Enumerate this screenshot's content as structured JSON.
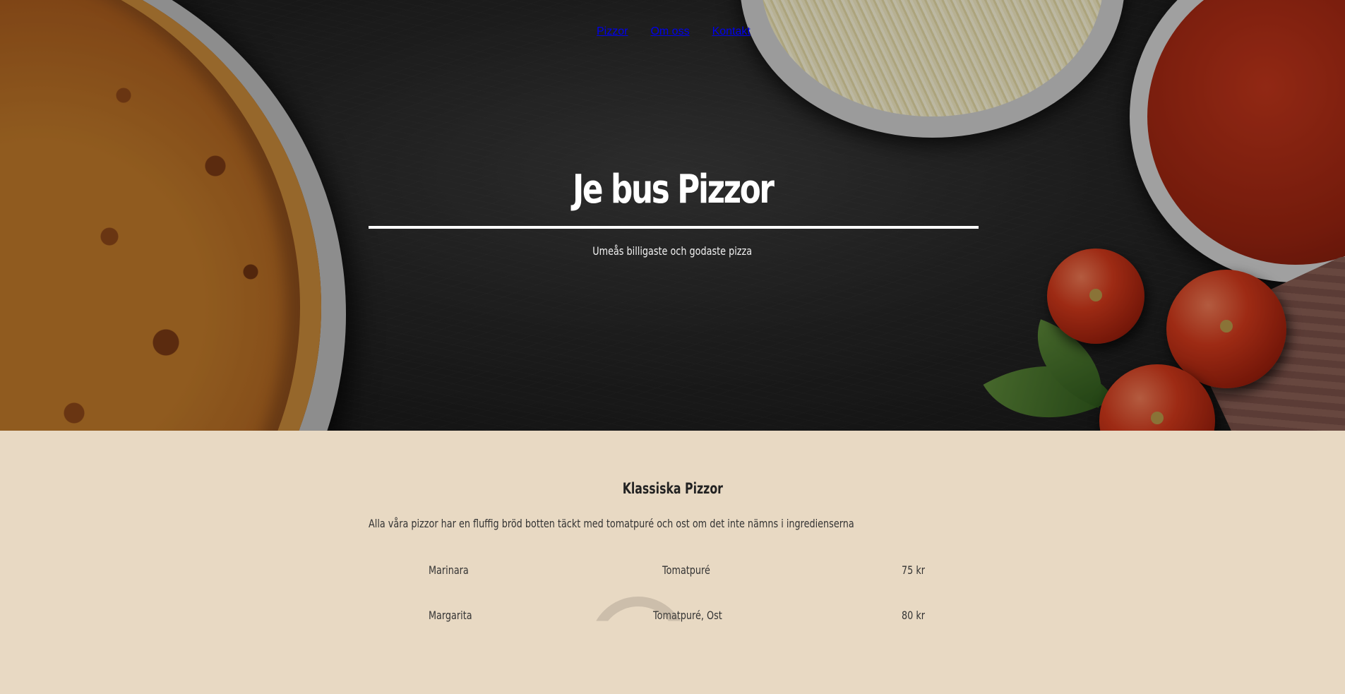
{
  "nav": {
    "items": [
      {
        "label": "Pizzor"
      },
      {
        "label": "Om oss"
      },
      {
        "label": "Kontakt"
      }
    ]
  },
  "hero": {
    "title": "Je bus Pizzor",
    "subtitle": "Umeås billigaste och godaste pizza"
  },
  "menu": {
    "title": "Klassiska Pizzor",
    "description": "Alla våra pizzor har en fluffig bröd botten täckt med tomatpuré och ost om det inte nämns i ingredienserna",
    "items": [
      {
        "name": "Marinara",
        "ingredients": "Tomatpuré",
        "price": "75 kr"
      },
      {
        "name": "Margarita",
        "ingredients": "Tomatpuré, Ost",
        "price": "80 kr"
      }
    ]
  },
  "colors": {
    "menu_background": "#e8d9c3",
    "nav_text": "#ffffff",
    "body_text": "#333333"
  }
}
